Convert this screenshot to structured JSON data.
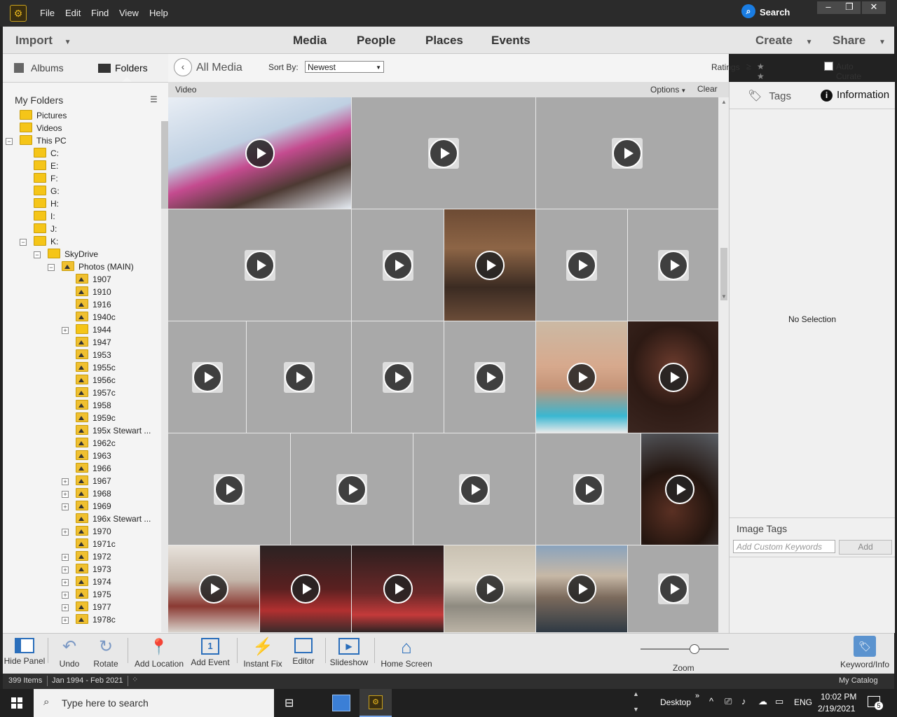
{
  "menubar": {
    "items": [
      "File",
      "Edit",
      "Find",
      "View",
      "Help"
    ],
    "search_label": "Search",
    "window_buttons": [
      "–",
      "❐",
      "✕"
    ]
  },
  "modebar": {
    "import_label": "Import",
    "tabs": [
      "Media",
      "People",
      "Places",
      "Events"
    ],
    "create_label": "Create",
    "share_label": "Share"
  },
  "left_panel": {
    "tabs": [
      "Albums",
      "Folders"
    ],
    "heading": "My Folders",
    "tree": [
      {
        "label": "Pictures",
        "level": 0,
        "expander": "",
        "photo": false
      },
      {
        "label": "Videos",
        "level": 0,
        "expander": "",
        "photo": false
      },
      {
        "label": "This PC",
        "level": 0,
        "expander": "−",
        "photo": false
      },
      {
        "label": "C:",
        "level": 1,
        "expander": "",
        "photo": false
      },
      {
        "label": "E:",
        "level": 1,
        "expander": "",
        "photo": false
      },
      {
        "label": "F:",
        "level": 1,
        "expander": "",
        "photo": false
      },
      {
        "label": "G:",
        "level": 1,
        "expander": "",
        "photo": false
      },
      {
        "label": "H:",
        "level": 1,
        "expander": "",
        "photo": false
      },
      {
        "label": "I:",
        "level": 1,
        "expander": "",
        "photo": false
      },
      {
        "label": "J:",
        "level": 1,
        "expander": "",
        "photo": false
      },
      {
        "label": "K:",
        "level": 1,
        "expander": "−",
        "photo": false
      },
      {
        "label": "SkyDrive",
        "level": 2,
        "expander": "−",
        "photo": false
      },
      {
        "label": "Photos (MAIN)",
        "level": 3,
        "expander": "−",
        "photo": true
      },
      {
        "label": "1907",
        "level": 4,
        "expander": "",
        "photo": true
      },
      {
        "label": "1910",
        "level": 4,
        "expander": "",
        "photo": true
      },
      {
        "label": "1916",
        "level": 4,
        "expander": "",
        "photo": true
      },
      {
        "label": "1940c",
        "level": 4,
        "expander": "",
        "photo": true
      },
      {
        "label": "1944",
        "level": 4,
        "expander": "+",
        "photo": false
      },
      {
        "label": "1947",
        "level": 4,
        "expander": "",
        "photo": true
      },
      {
        "label": "1953",
        "level": 4,
        "expander": "",
        "photo": true
      },
      {
        "label": "1955c",
        "level": 4,
        "expander": "",
        "photo": true
      },
      {
        "label": "1956c",
        "level": 4,
        "expander": "",
        "photo": true
      },
      {
        "label": "1957c",
        "level": 4,
        "expander": "",
        "photo": true
      },
      {
        "label": "1958",
        "level": 4,
        "expander": "",
        "photo": true
      },
      {
        "label": "1959c",
        "level": 4,
        "expander": "",
        "photo": true
      },
      {
        "label": "195x Stewart ...",
        "level": 4,
        "expander": "",
        "photo": true
      },
      {
        "label": "1962c",
        "level": 4,
        "expander": "",
        "photo": true
      },
      {
        "label": "1963",
        "level": 4,
        "expander": "",
        "photo": true
      },
      {
        "label": "1966",
        "level": 4,
        "expander": "",
        "photo": true
      },
      {
        "label": "1967",
        "level": 4,
        "expander": "+",
        "photo": true
      },
      {
        "label": "1968",
        "level": 4,
        "expander": "+",
        "photo": true
      },
      {
        "label": "1969",
        "level": 4,
        "expander": "+",
        "photo": true
      },
      {
        "label": "196x Stewart ...",
        "level": 4,
        "expander": "",
        "photo": true
      },
      {
        "label": "1970",
        "level": 4,
        "expander": "+",
        "photo": true
      },
      {
        "label": "1971c",
        "level": 4,
        "expander": "",
        "photo": true
      },
      {
        "label": "1972",
        "level": 4,
        "expander": "+",
        "photo": true
      },
      {
        "label": "1973",
        "level": 4,
        "expander": "+",
        "photo": true
      },
      {
        "label": "1974",
        "level": 4,
        "expander": "+",
        "photo": true
      },
      {
        "label": "1975",
        "level": 4,
        "expander": "+",
        "photo": true
      },
      {
        "label": "1977",
        "level": 4,
        "expander": "+",
        "photo": true
      },
      {
        "label": "1978c",
        "level": 4,
        "expander": "+",
        "photo": true
      }
    ]
  },
  "center": {
    "breadcrumb": "All Media",
    "sort_label": "Sort By:",
    "sort_value": "Newest",
    "ratings_label": "Ratings",
    "ratings_op": "≥",
    "stars": "★ ★ ★ ★ ★",
    "auto_curate_label": "Auto Curate",
    "filter_label": "Video",
    "options_label": "Options",
    "clear_label": "Clear"
  },
  "right_panel": {
    "tabs": [
      "Tags",
      "Information"
    ],
    "no_selection": "No Selection",
    "image_tags_label": "Image Tags",
    "keyword_placeholder": "Add Custom Keywords",
    "add_label": "Add"
  },
  "toolbar": {
    "hide_panel": "Hide Panel",
    "undo": "Undo",
    "rotate": "Rotate",
    "add_location": "Add Location",
    "add_event": "Add Event",
    "instant_fix": "Instant Fix",
    "editor": "Editor",
    "slideshow": "Slideshow",
    "home_screen": "Home Screen",
    "zoom": "Zoom",
    "keyword_info": "Keyword/Info"
  },
  "statusbar": {
    "items": "399 Items",
    "date_range": "Jan 1994 - Feb 2021",
    "catalog": "My Catalog"
  },
  "taskbar": {
    "search_placeholder": "Type here to search",
    "desktop_label": "Desktop",
    "lang": "ENG",
    "time": "10:02 PM",
    "date": "2/19/2021",
    "notification_count": "5"
  },
  "colors": {
    "accent_blue": "#1a7de3",
    "tile_grey": "#a9a9a9",
    "folder_yellow": "#f5c518"
  }
}
